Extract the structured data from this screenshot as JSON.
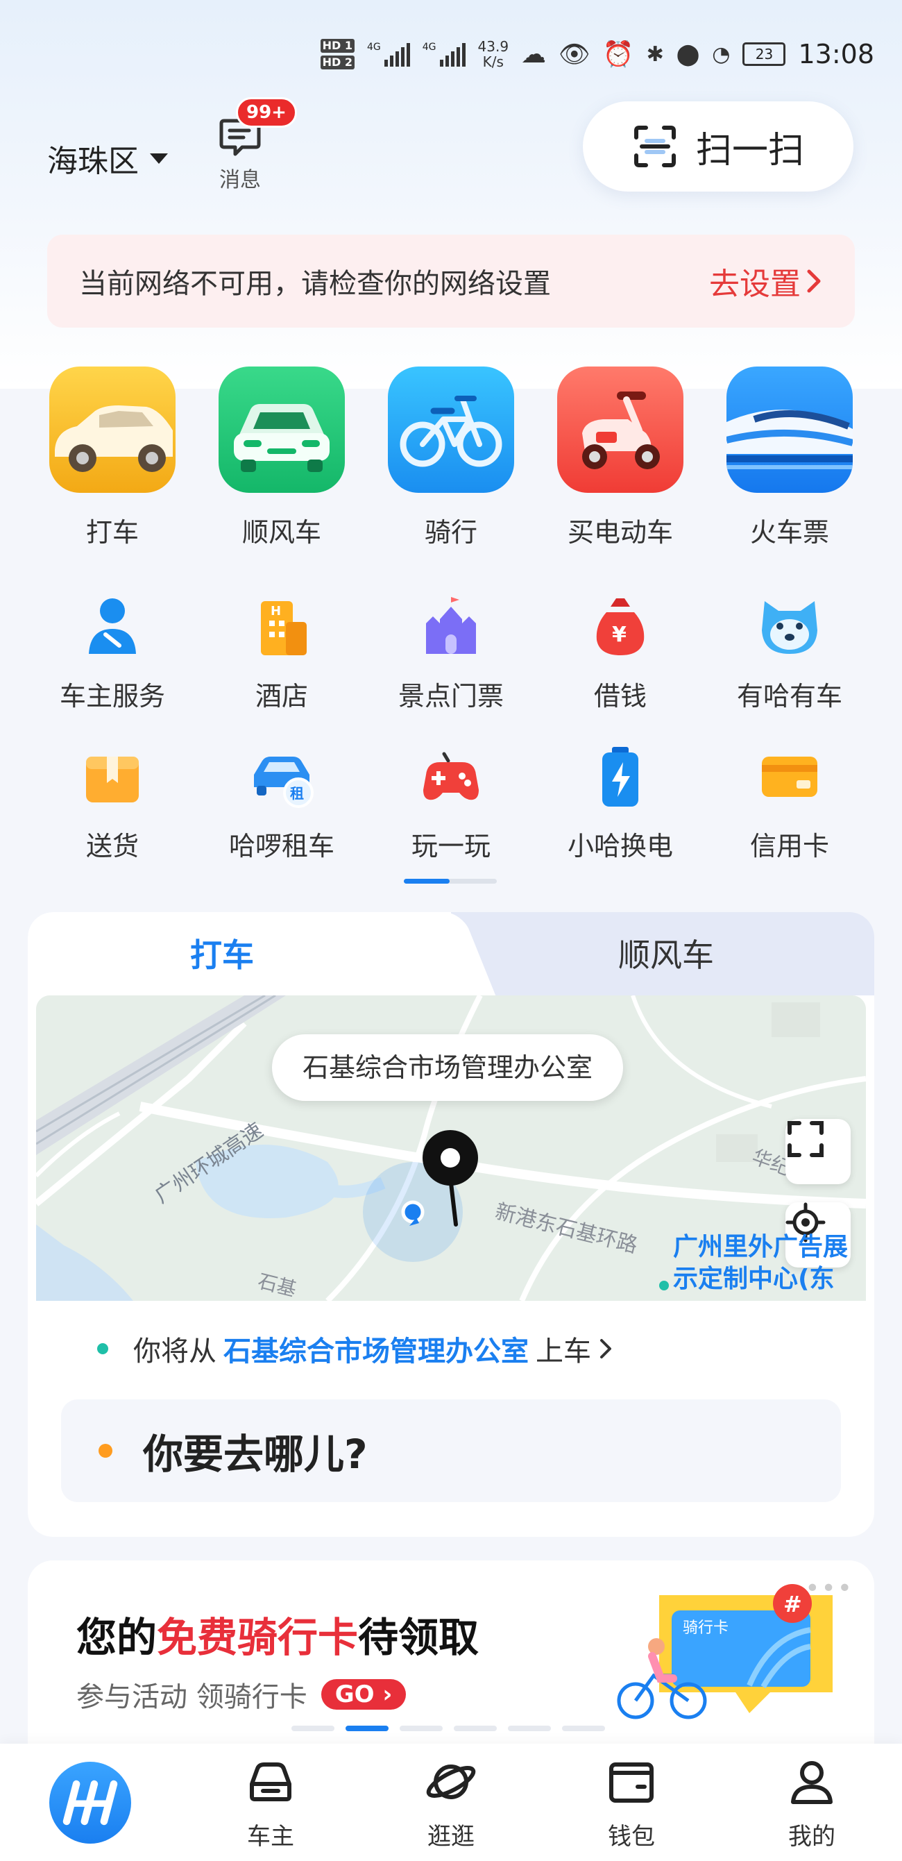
{
  "status_bar": {
    "hd1": "HD 1",
    "hd2": "HD 2",
    "net1": "4G",
    "net2": "4G",
    "speed_value": "43.9",
    "speed_unit": "K/s",
    "battery": "23",
    "time": "13:08"
  },
  "header": {
    "location": "海珠区",
    "message_label": "消息",
    "message_badge": "99+",
    "scan_label": "扫一扫"
  },
  "network_banner": {
    "text": "当前网络不可用，请检查你的网络设置",
    "action": "去设置"
  },
  "services_main": [
    {
      "label": "打车",
      "icon": "taxi-car-icon"
    },
    {
      "label": "顺风车",
      "icon": "carpool-car-icon"
    },
    {
      "label": "骑行",
      "icon": "bicycle-icon"
    },
    {
      "label": "买电动车",
      "icon": "e-scooter-icon"
    },
    {
      "label": "火车票",
      "icon": "train-icon"
    }
  ],
  "services_row2": [
    {
      "label": "车主服务",
      "icon": "driver-service-icon"
    },
    {
      "label": "酒店",
      "icon": "hotel-icon"
    },
    {
      "label": "景点门票",
      "icon": "castle-icon"
    },
    {
      "label": "借钱",
      "icon": "money-bag-icon"
    },
    {
      "label": "有哈有车",
      "icon": "husky-icon"
    }
  ],
  "services_row3": [
    {
      "label": "送货",
      "icon": "package-icon"
    },
    {
      "label": "哈啰租车",
      "icon": "rental-car-icon"
    },
    {
      "label": "玩一玩",
      "icon": "gamepad-icon"
    },
    {
      "label": "小哈换电",
      "icon": "battery-swap-icon"
    },
    {
      "label": "信用卡",
      "icon": "credit-card-icon"
    }
  ],
  "ride_card": {
    "tabs": [
      "打车",
      "顺风车"
    ],
    "map": {
      "pickup_pill": "石基综合市场管理办公室",
      "road1": "广州环城高速",
      "road2": "新港东石基环路",
      "road3": "华纪路",
      "road4": "石基",
      "poi_line1": "广州里外广告展",
      "poi_line2": "示定制中心(东"
    },
    "pickup_prefix": "你将从",
    "pickup_place": "石基综合市场管理办公室",
    "pickup_suffix": "上车",
    "destination_placeholder": "你要去哪儿?"
  },
  "promo": {
    "title_a": "您的",
    "title_b": "免费骑行卡",
    "title_c": "待领取",
    "subtitle": "参与活动 领骑行卡",
    "go": "GO",
    "card_label": "骑行卡",
    "more": "•••",
    "slide_count": 6,
    "active_slide": 2
  },
  "bottom_nav": [
    {
      "label": "",
      "icon": "hello-logo-icon"
    },
    {
      "label": "车主",
      "icon": "car-outline-icon"
    },
    {
      "label": "逛逛",
      "icon": "planet-icon"
    },
    {
      "label": "钱包",
      "icon": "wallet-icon"
    },
    {
      "label": "我的",
      "icon": "person-icon"
    }
  ],
  "colors": {
    "accent": "#1a7ff0",
    "alert": "#e53a3a",
    "pickup_dot": "#1fbfa8",
    "dest_dot": "#ff9c1f"
  }
}
